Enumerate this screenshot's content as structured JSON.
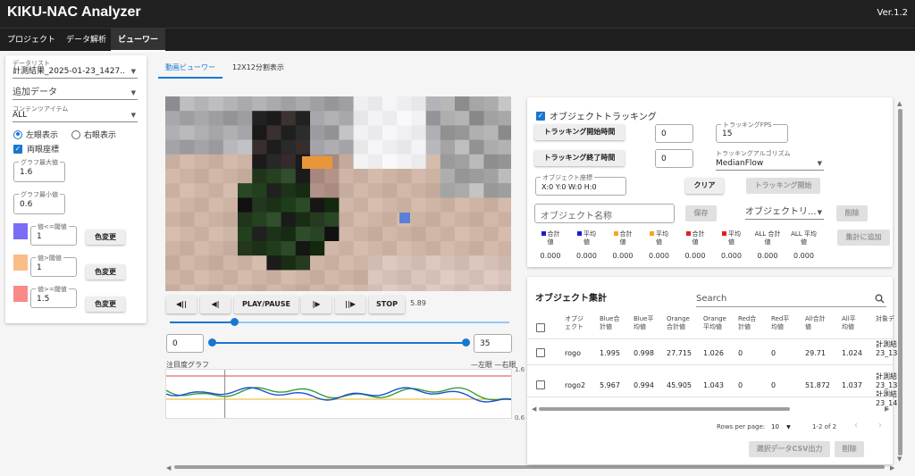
{
  "app": {
    "title": "KIKU-NAC Analyzer",
    "version": "Ver.1.2"
  },
  "nav": [
    "プロジェクト",
    "データ解析",
    "ビューワー"
  ],
  "left": {
    "datalist_label": "データリスト",
    "datalist_value": "計測結果_2025-01-23_1427...",
    "add_data": "追加データ",
    "content_label": "コンテンツアイテム",
    "content_value": "ALL",
    "left_eye": "左眼表示",
    "right_eye": "右眼表示",
    "both_eye": "両眼座標",
    "graph_max_label": "グラフ最大値",
    "graph_max_value": "1.6",
    "graph_min_label": "グラフ最小値",
    "graph_min_value": "0.6",
    "thresholds": [
      {
        "label": "値<=閾値",
        "value": "1",
        "color": "#7b6cf5"
      },
      {
        "label": "値>閾値",
        "value": "1",
        "color": "#f9be88"
      },
      {
        "label": "値>=閾値",
        "value": "1.5",
        "color": "#f98a8a"
      }
    ],
    "color_change": "色変更"
  },
  "tabs": [
    "動画ビューワー",
    "12X12分割表示"
  ],
  "player": {
    "btn_prev_end": "◀||",
    "btn_prev": "◀|",
    "btn_play": "PLAY/PAUSE",
    "btn_next": "|▶",
    "btn_next_end": "||▶",
    "btn_stop": "STOP",
    "time": "5.89",
    "progress": 0.19,
    "range_start": "0",
    "range_end": "35"
  },
  "graph": {
    "label": "注目度グラフ",
    "legend": "—左眼 —右眼",
    "max": "1.6",
    "min": "0.6",
    "cursor_fraction": 0.17,
    "left_line_color": "#2e9e3a",
    "right_line_color": "#1f4fd1"
  },
  "tracking": {
    "checkbox": "オブジェクトトラッキング",
    "start_time_btn": "トラッキング開始時間",
    "start_time_val": "0",
    "end_time_btn": "トラッキング終了時間",
    "end_time_val": "0",
    "fps_label": "トラッキングFPS",
    "fps_value": "15",
    "algo_label": "トラッキングアルゴリズム",
    "algo_value": "MedianFlow",
    "coord_label": "オブジェクト座標",
    "coord_value": "X:0 Y:0 W:0 H:0",
    "clear_btn": "クリア",
    "tracking_start_btn": "トラッキング開始",
    "name_placeholder": "オブジェクト名称",
    "save_btn": "保存",
    "object_select": "オブジェクトリ...",
    "delete_btn": "削除",
    "add_total_btn": "集計に追加",
    "stats": [
      {
        "color": "#1a1ad6",
        "l1": "合計",
        "l2": "値",
        "value": "0.000"
      },
      {
        "color": "#1a1ad6",
        "l1": "平均",
        "l2": "値",
        "value": "0.000"
      },
      {
        "color": "#f5a623",
        "l1": "合計",
        "l2": "値",
        "value": "0.000"
      },
      {
        "color": "#f5a623",
        "l1": "平均",
        "l2": "値",
        "value": "0.000"
      },
      {
        "color": "#e02020",
        "l1": "合計",
        "l2": "値",
        "value": "0.000"
      },
      {
        "color": "#e02020",
        "l1": "平均",
        "l2": "値",
        "value": "0.000"
      },
      {
        "color": "",
        "l1": "ALL 合計",
        "l2": "値",
        "value": "0.000"
      },
      {
        "color": "",
        "l1": "ALL 平均",
        "l2": "値",
        "value": "0.000"
      }
    ]
  },
  "summary": {
    "title": "オブジェクト集計",
    "search_placeholder": "Search",
    "headers": [
      [
        "オブジ",
        "ェクト"
      ],
      [
        "Blue合",
        "計値"
      ],
      [
        "Blue平",
        "均値"
      ],
      [
        "Orange",
        "合計値"
      ],
      [
        "Orange",
        "平均値"
      ],
      [
        "Red合",
        "計値"
      ],
      [
        "Red平",
        "均値"
      ],
      [
        "All合計",
        "値"
      ],
      [
        "All平",
        "均値"
      ],
      [
        "対象デ",
        ""
      ]
    ],
    "rows": [
      {
        "name": "rogo",
        "blue_sum": "1.995",
        "blue_avg": "0.998",
        "orange_sum": "27.715",
        "orange_avg": "1.026",
        "red_sum": "0",
        "red_avg": "0",
        "all_sum": "29.71",
        "all_avg": "1.024",
        "target": [
          "計測結",
          "23_13"
        ]
      },
      {
        "name": "rogo2",
        "blue_sum": "5.967",
        "blue_avg": "0.994",
        "orange_sum": "45.905",
        "orange_avg": "1.043",
        "red_sum": "0",
        "red_avg": "0",
        "all_sum": "51.872",
        "all_avg": "1.037",
        "target": [
          "計測結",
          "23_13",
          "計測結",
          "23_14"
        ]
      }
    ],
    "rows_per_page_label": "Rows per page:",
    "rows_per_page_value": "10",
    "page_info": "1-2 of 2",
    "csv_btn": "選択データCSV出力",
    "delete_btn": "削除"
  }
}
